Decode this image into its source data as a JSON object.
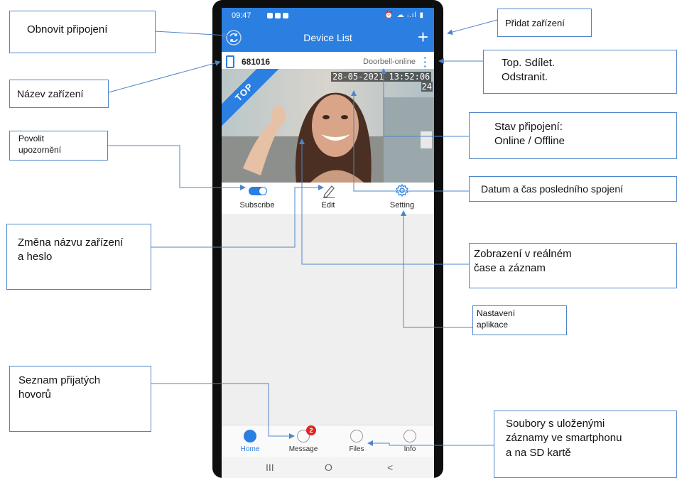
{
  "status_bar": {
    "time": "09:47",
    "right_icons": "⏰ ☁ ᵢ.ıl ▮"
  },
  "app_bar": {
    "title": "Device List",
    "add_icon": "+"
  },
  "device": {
    "name": "681016",
    "status": "Doorbell-online",
    "ribbon": "TOP",
    "timestamp": "28-05-2021 13:52:06",
    "side_number": "24"
  },
  "actions": [
    {
      "label": "Subscribe",
      "icon": "toggle-icon",
      "checked": true
    },
    {
      "label": "Edit",
      "icon": "pencil-icon"
    },
    {
      "label": "Setting",
      "icon": "gear-icon"
    }
  ],
  "tabs": [
    {
      "label": "Home",
      "icon": "home-icon",
      "active": true
    },
    {
      "label": "Message",
      "icon": "message-icon",
      "badge": "2"
    },
    {
      "label": "Files",
      "icon": "files-icon"
    },
    {
      "label": "Info",
      "icon": "info-icon"
    }
  ],
  "nav_buttons": [
    "III",
    "O",
    "<"
  ],
  "colors": {
    "accent": "#2a7fe0",
    "callout_border": "#4f85c9",
    "badge": "#e02424"
  },
  "callouts": {
    "refresh": "Obnovit připojení",
    "add_device": "Přidat zařízení",
    "device_name": "Název zařízení",
    "menu": {
      "line1": "Top. Sdílet.",
      "line2": "Odstranit."
    },
    "notifications": {
      "line1": "Povolit",
      "line2": "upozornění"
    },
    "connection_state": {
      "line1": "Stav připojení:",
      "line2": "Online / Offline"
    },
    "last_connection": "Datum a čas posledního spojení",
    "rename": {
      "line1": "Změna názvu zařízení",
      "line2": "a heslo"
    },
    "live_view": {
      "line1": "Zobrazení v reálném",
      "line2": "čase a záznam"
    },
    "app_settings": {
      "line1": "Nastavení",
      "line2": "aplikace"
    },
    "call_list": {
      "line1": "Seznam přijatých",
      "line2": "hovorů"
    },
    "files": {
      "line1": "Soubory s uloženými",
      "line2": "záznamy ve smartphonu",
      "line3": "a na SD kartě"
    }
  }
}
